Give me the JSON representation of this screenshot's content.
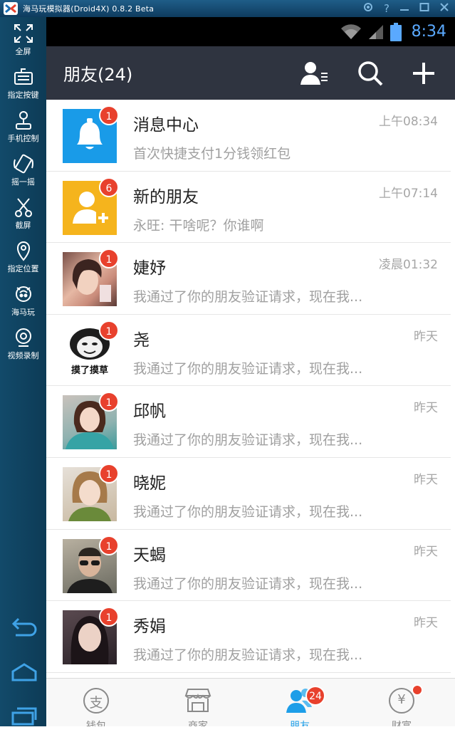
{
  "emulator": {
    "title": "海马玩模拟器(Droid4X) 0.8.2 Beta",
    "window_controls": [
      "settings-icon",
      "help-icon",
      "minimize-icon",
      "maximize-icon",
      "close-icon"
    ],
    "sidebar": [
      {
        "label": "全屏",
        "icon": "fullscreen-icon"
      },
      {
        "label": "指定按键",
        "icon": "keyboard-icon"
      },
      {
        "label": "手机控制",
        "icon": "phone-control-icon"
      },
      {
        "label": "摇一摇",
        "icon": "shake-icon"
      },
      {
        "label": "截屏",
        "icon": "scissors-icon"
      },
      {
        "label": "指定位置",
        "icon": "location-icon"
      },
      {
        "label": "海马玩",
        "icon": "haima-icon"
      },
      {
        "label": "视频录制",
        "icon": "video-record-icon"
      }
    ],
    "nav": [
      "back-icon",
      "home-icon",
      "recents-icon"
    ]
  },
  "status_bar": {
    "time": "8:34"
  },
  "header": {
    "title": "朋友(24)",
    "actions": [
      "contacts-icon",
      "search-icon",
      "add-icon"
    ]
  },
  "chats": [
    {
      "name": "消息中心",
      "message": "首次快捷支付1分钱领红包",
      "time": "上午08:34",
      "badge": "1",
      "avatar": "bell"
    },
    {
      "name": "新的朋友",
      "message": "永旺: 干啥呢？你谁啊",
      "time": "上午07:14",
      "badge": "6",
      "avatar": "add-friend"
    },
    {
      "name": "婕妤",
      "message": "我通过了你的朋友验证请求，现在我...",
      "time": "凌晨01:32",
      "badge": "1",
      "avatar": "photo"
    },
    {
      "name": "尧",
      "message": "我通过了你的朋友验证请求，现在我...",
      "time": "昨天",
      "badge": "1",
      "avatar": "meme",
      "avatar_caption": "摸了摸草"
    },
    {
      "name": "邱帆",
      "message": "我通过了你的朋友验证请求，现在我...",
      "time": "昨天",
      "badge": "1",
      "avatar": "photo"
    },
    {
      "name": "晓妮",
      "message": "我通过了你的朋友验证请求，现在我...",
      "time": "昨天",
      "badge": "1",
      "avatar": "photo"
    },
    {
      "name": "天蝎",
      "message": "我通过了你的朋友验证请求，现在我...",
      "time": "昨天",
      "badge": "1",
      "avatar": "photo"
    },
    {
      "name": "秀娟",
      "message": "我通过了你的朋友验证请求，现在我...",
      "time": "昨天",
      "badge": "1",
      "avatar": "photo"
    }
  ],
  "tabs": [
    {
      "label": "钱包",
      "icon": "wallet-icon",
      "icon_text": "支"
    },
    {
      "label": "商家",
      "icon": "store-icon"
    },
    {
      "label": "朋友",
      "icon": "friends-icon",
      "badge": "24",
      "active": true
    },
    {
      "label": "财富",
      "icon": "wealth-icon",
      "icon_text": "¥",
      "dot": true
    }
  ],
  "colors": {
    "header_bg": "#2f3440",
    "accent_blue": "#1d9ee8",
    "badge_red": "#e8412d",
    "status_time": "#5aa9ff",
    "bell_bg": "#199be8",
    "add_friend_bg": "#f5b41d"
  }
}
